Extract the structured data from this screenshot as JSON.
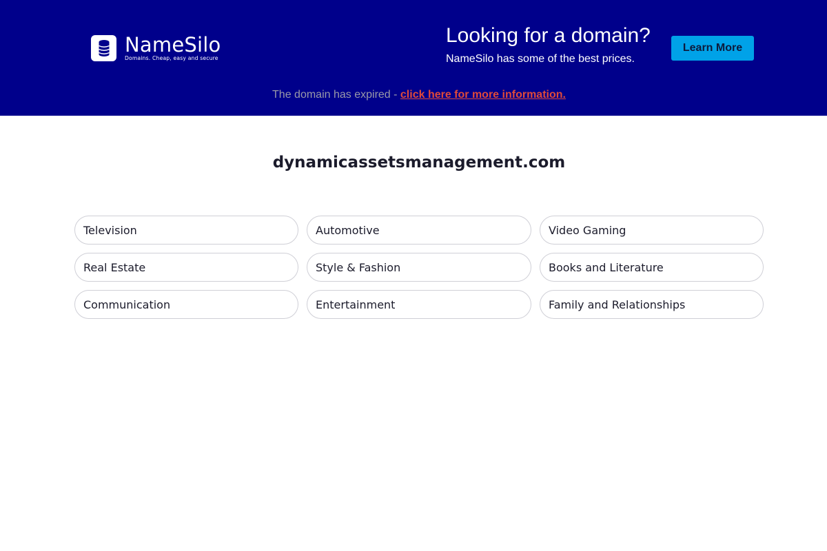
{
  "header": {
    "logo": {
      "name": "NameSilo",
      "tagline": "Domains. Cheap, easy and secure"
    },
    "promo": {
      "title": "Looking for a domain?",
      "subtitle": "NameSilo has some of the best prices."
    },
    "learn_more_label": "Learn More",
    "expired_notice": {
      "text": "The domain has expired - ",
      "link_text": "click here for more information."
    },
    "colors": {
      "banner_bg": "#00008b",
      "button_bg": "#00a2e8",
      "link": "#e04a3a"
    }
  },
  "main": {
    "domain": "dynamicassetsmanagement.com",
    "categories": [
      "Television",
      "Automotive",
      "Video Gaming",
      "Real Estate",
      "Style & Fashion",
      "Books and Literature",
      "Communication",
      "Entertainment",
      "Family and Relationships"
    ]
  }
}
